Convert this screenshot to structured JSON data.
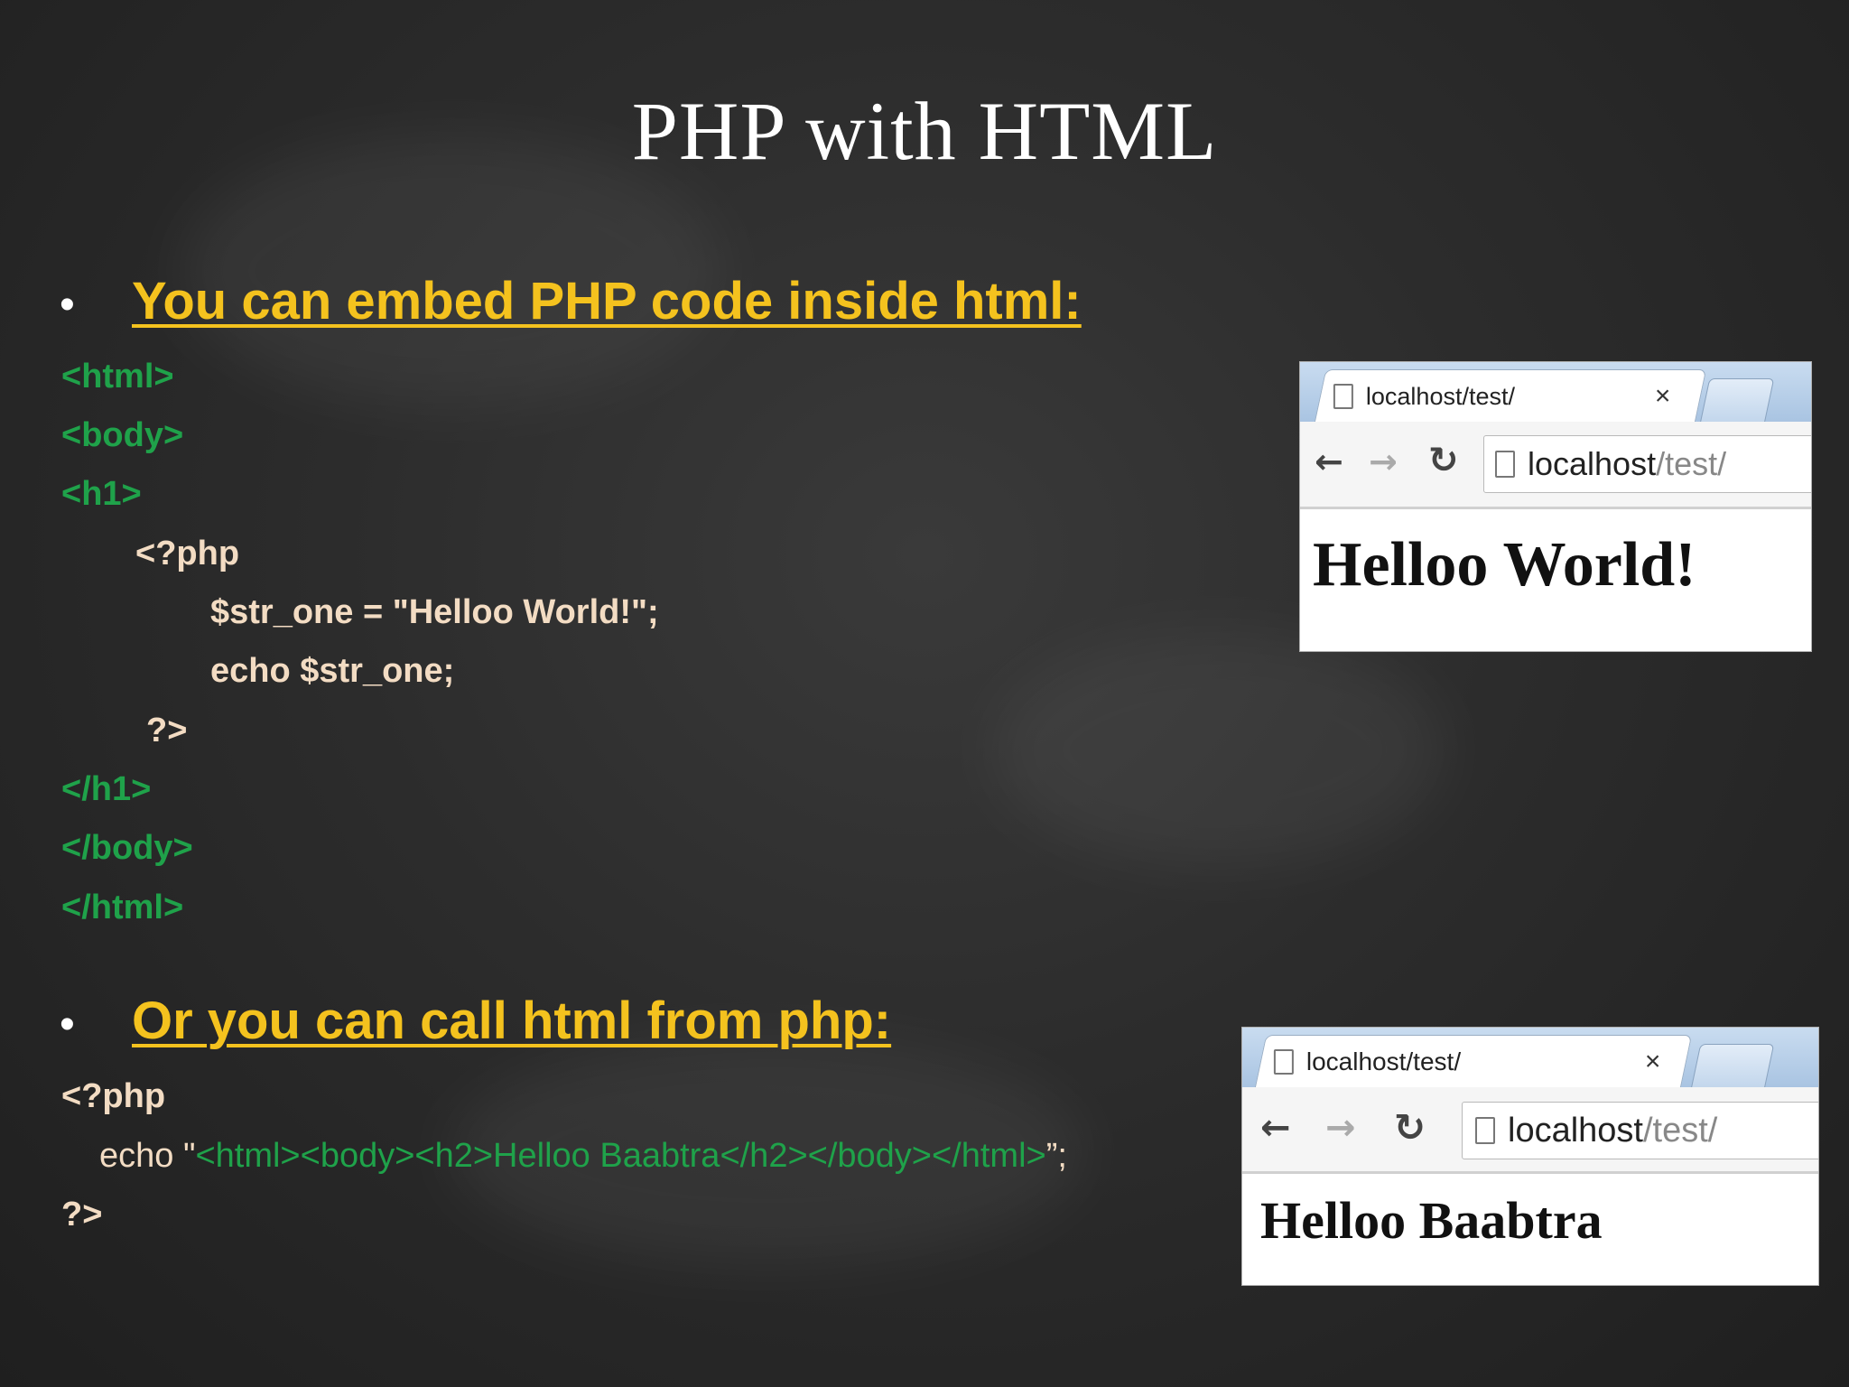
{
  "slide": {
    "title": "PHP with HTML"
  },
  "section1": {
    "bullet": "•",
    "heading": "You can embed  PHP code inside html:",
    "code": [
      "<html>",
      "<body>",
      "<h1>",
      "<?php",
      "$str_one = \"Helloo World!\";",
      "echo $str_one;",
      "?>",
      "</h1>",
      "</body>",
      "</html>"
    ]
  },
  "section2": {
    "bullet": "•",
    "heading": "Or you can call html from php:",
    "code_open": "<?php",
    "echo_prefix": "echo \"",
    "echo_html": "<html><body><h2>Helloo Baabtra</h2></body></html>",
    "echo_suffix": "”;",
    "code_close": "?>"
  },
  "browser1": {
    "tab_title": "localhost/test/",
    "tab_close": "×",
    "back_icon": "arrow-left-icon",
    "forward_icon": "arrow-right-icon",
    "reload_icon": "reload-icon",
    "url_host": "localhost",
    "url_path": "/test/",
    "page_text": "Helloo World!"
  },
  "browser2": {
    "tab_title": "localhost/test/",
    "tab_close": "×",
    "back_icon": "arrow-left-icon",
    "forward_icon": "arrow-right-icon",
    "reload_icon": "reload-icon",
    "url_host": "localhost",
    "url_path": "/test/",
    "page_text": "Helloo Baabtra"
  },
  "colors": {
    "heading_yellow": "#f4c21e",
    "code_green": "#1fa24a",
    "code_cream": "#f3dcc3",
    "background": "#2c2c2c"
  }
}
